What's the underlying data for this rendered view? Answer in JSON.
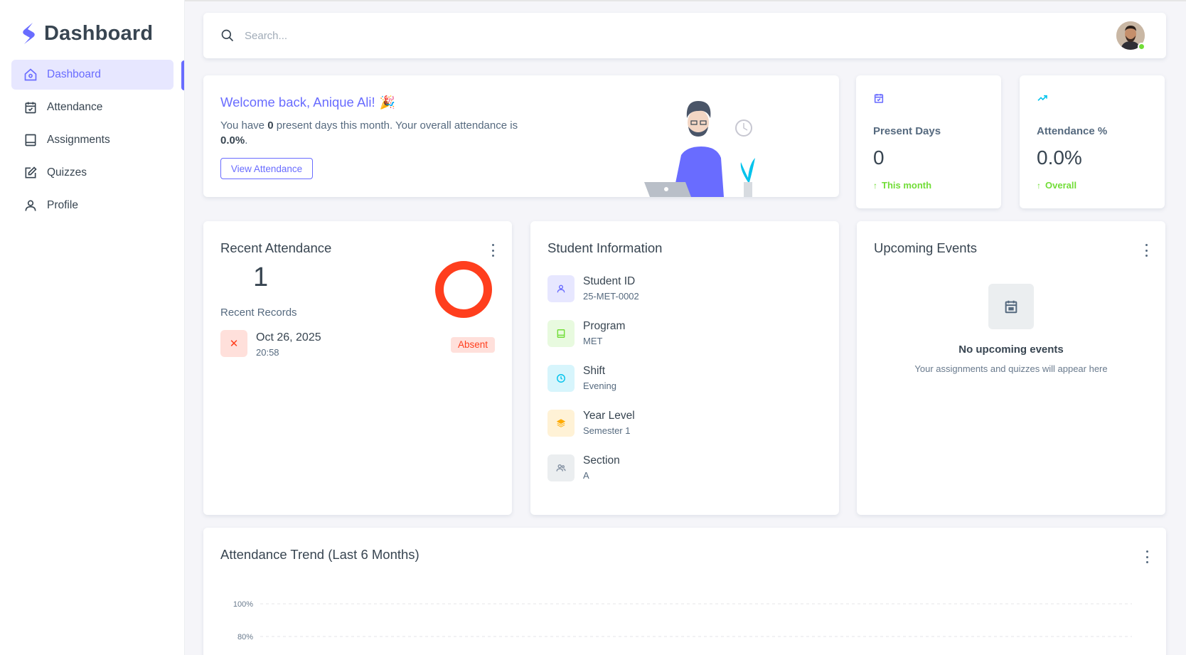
{
  "brand": {
    "name": "Dashboard"
  },
  "sidebar": {
    "items": [
      {
        "label": "Dashboard",
        "icon": "home-icon",
        "active": true
      },
      {
        "label": "Attendance",
        "icon": "calendar-check-icon"
      },
      {
        "label": "Assignments",
        "icon": "book-icon"
      },
      {
        "label": "Quizzes",
        "icon": "edit-icon"
      },
      {
        "label": "Profile",
        "icon": "user-icon"
      }
    ]
  },
  "navbar": {
    "search_placeholder": "Search...",
    "user_online": true
  },
  "welcome": {
    "title": "Welcome back, Anique Ali!",
    "emoji": "🎉",
    "text_prefix": "You have ",
    "present_days": "0",
    "text_middle": " present days this month. Your overall attendance is ",
    "overall": "0.0%",
    "text_suffix": ".",
    "button": "View Attendance"
  },
  "stats": [
    {
      "label": "Present Days",
      "value": "0",
      "trend": "This month",
      "icon": "calendar-check-icon",
      "icon_color": "#696cff"
    },
    {
      "label": "Attendance %",
      "value": "0.0%",
      "trend": "Overall",
      "icon": "trending-up-icon",
      "icon_color": "#03c3ec"
    }
  ],
  "recent_attendance": {
    "title": "Recent Attendance",
    "count": "1",
    "records_label": "Recent Records",
    "absent_share": 1.0,
    "records": [
      {
        "date": "Oct 26, 2025",
        "time": "20:58",
        "status": "Absent"
      }
    ]
  },
  "student_info": {
    "title": "Student Information",
    "items": [
      {
        "label": "Student ID",
        "value": "25-MET-0002",
        "icon": "user-icon",
        "bg": "#e7e7ff",
        "fg": "#696cff"
      },
      {
        "label": "Program",
        "value": "MET",
        "icon": "book-icon",
        "bg": "#e8fadf",
        "fg": "#71dd37"
      },
      {
        "label": "Shift",
        "value": "Evening",
        "icon": "clock-icon",
        "bg": "#d7f5fc",
        "fg": "#03c3ec"
      },
      {
        "label": "Year Level",
        "value": "Semester 1",
        "icon": "layers-icon",
        "bg": "#fff2d6",
        "fg": "#ffab00"
      },
      {
        "label": "Section",
        "value": "A",
        "icon": "users-icon",
        "bg": "#ebeef0",
        "fg": "#8592a3"
      }
    ]
  },
  "events": {
    "title": "Upcoming Events",
    "empty_title": "No upcoming events",
    "empty_sub": "Your assignments and quizzes will appear here"
  },
  "trend": {
    "title": "Attendance Trend (Last 6 Months)",
    "y_ticks": [
      "100%",
      "80%"
    ]
  },
  "colors": {
    "primary": "#696cff",
    "success": "#71dd37",
    "danger": "#ff3e1d",
    "info": "#03c3ec",
    "heading": "#384551"
  }
}
